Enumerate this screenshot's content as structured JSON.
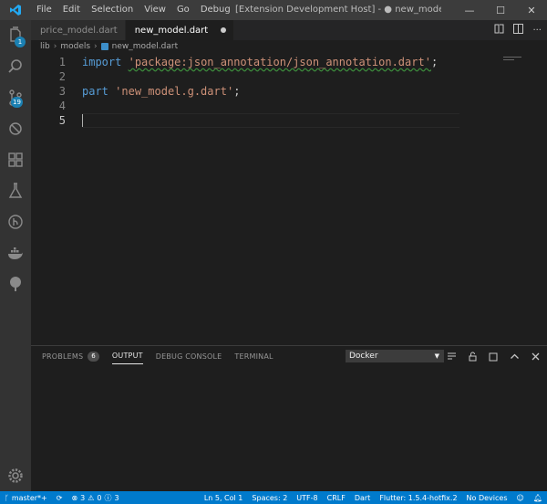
{
  "menu": [
    "File",
    "Edit",
    "Selection",
    "View",
    "Go",
    "Debug"
  ],
  "window_title": "[Extension Development Host] - ● new_model.dart - bitcoin - Visual Studio Code",
  "tabs": [
    {
      "label": "price_model.dart",
      "active": false
    },
    {
      "label": "new_model.dart",
      "active": true,
      "modified": true
    }
  ],
  "breadcrumb": [
    "lib",
    "models",
    "new_model.dart"
  ],
  "activity": {
    "scm_badge": "19",
    "explorer_badge": "1"
  },
  "code_lines": [
    {
      "n": "1",
      "kw": "import",
      "str": "'package:json_annotation/json_annotation.dart'",
      "tail": ";"
    },
    {
      "n": "2",
      "kw": "",
      "str": "",
      "tail": ""
    },
    {
      "n": "3",
      "kw": "part",
      "str": "'new_model.g.dart'",
      "tail": ";"
    },
    {
      "n": "4",
      "kw": "",
      "str": "",
      "tail": ""
    },
    {
      "n": "5",
      "kw": "",
      "str": "",
      "tail": ""
    }
  ],
  "panel": {
    "tabs": [
      {
        "label": "PROBLEMS",
        "count": "6",
        "active": false
      },
      {
        "label": "OUTPUT",
        "count": "",
        "active": true
      },
      {
        "label": "DEBUG CONSOLE",
        "count": "",
        "active": false
      },
      {
        "label": "TERMINAL",
        "count": "",
        "active": false
      }
    ],
    "output_channel": "Docker"
  },
  "status": {
    "branch": "master*+",
    "errors": "3",
    "warnings": "0",
    "info": "3",
    "position": "Ln 5, Col 1",
    "spaces": "Spaces: 2",
    "encoding": "UTF-8",
    "eol": "CRLF",
    "language": "Dart",
    "flutter": "Flutter: 1.5.4-hotfix.2",
    "devices": "No Devices"
  },
  "colors": {
    "accent": "#007acc",
    "keyword": "#569cd6",
    "string": "#ce9178"
  }
}
